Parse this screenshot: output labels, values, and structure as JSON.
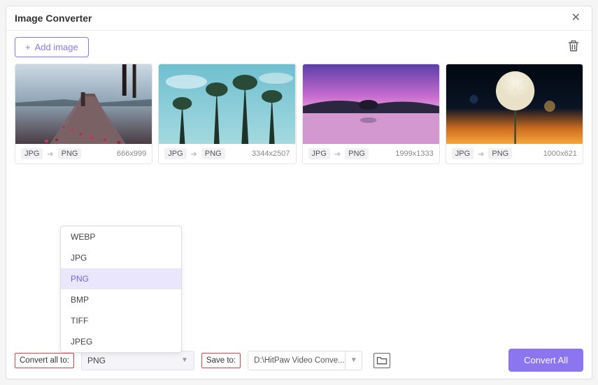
{
  "title": "Image Converter",
  "toolbar": {
    "add_label": "Add image",
    "add_prefix": "+"
  },
  "images": [
    {
      "from": "JPG",
      "to": "PNG",
      "dim": "666x999"
    },
    {
      "from": "JPG",
      "to": "PNG",
      "dim": "3344x2507"
    },
    {
      "from": "JPG",
      "to": "PNG",
      "dim": "1999x1333"
    },
    {
      "from": "JPG",
      "to": "PNG",
      "dim": "1000x621"
    }
  ],
  "format_options": [
    "WEBP",
    "JPG",
    "PNG",
    "BMP",
    "TIFF",
    "JPEG"
  ],
  "format_selected": "PNG",
  "footer": {
    "convert_label": "Convert all to:",
    "format_value": "PNG",
    "save_label": "Save to:",
    "save_path": "D:\\HitPaw Video Conve...",
    "convert_all": "Convert All"
  }
}
